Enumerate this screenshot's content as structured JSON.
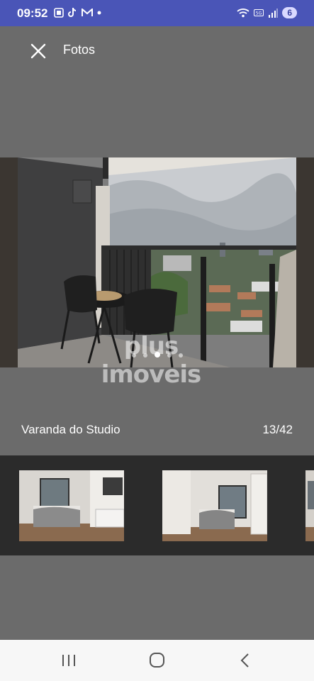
{
  "status_bar": {
    "time": "09:52",
    "battery_level": "6",
    "icons_left": [
      "screenshot-icon",
      "tiktok-icon",
      "gmail-icon",
      "dot-icon"
    ],
    "icons_right": [
      "wifi-icon",
      "5g-icon",
      "signal-icon",
      "battery-icon"
    ]
  },
  "header": {
    "title": "Fotos",
    "close_icon": "close-icon"
  },
  "photo": {
    "watermark": "plus imoveis",
    "dots_count": 5,
    "active_dot": 2
  },
  "caption": {
    "label": "Varanda do Studio",
    "counter": "13/42"
  },
  "thumbnails": {
    "count_visible": 3
  },
  "nav_bar": {
    "buttons": [
      "recent-apps-icon",
      "home-icon",
      "back-icon"
    ]
  }
}
